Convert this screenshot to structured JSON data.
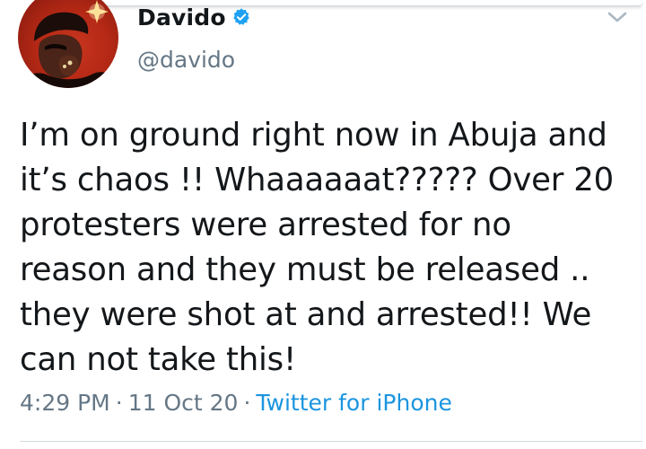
{
  "author": {
    "display_name": "Davido",
    "handle": "@davido",
    "verified": true,
    "avatar_icon": "profile-photo"
  },
  "tweet": {
    "text": "I’m on ground right now in Abuja and\nit’s chaos !! Whaaaaaat????? Over 20\nprotesters were arrested for no\nreason and they must be released ..\nthey were shot at and arrested!! We\ncan not take this!",
    "time": "4:29 PM",
    "separator": "·",
    "date": "11 Oct 20",
    "source": "Twitter for iPhone"
  },
  "icons": {
    "verified": "verified-badge-icon",
    "more": "chevron-down-icon"
  },
  "colors": {
    "text": "#14171a",
    "secondary": "#657786",
    "link": "#1b95e0",
    "verified": "#1da1f2"
  }
}
